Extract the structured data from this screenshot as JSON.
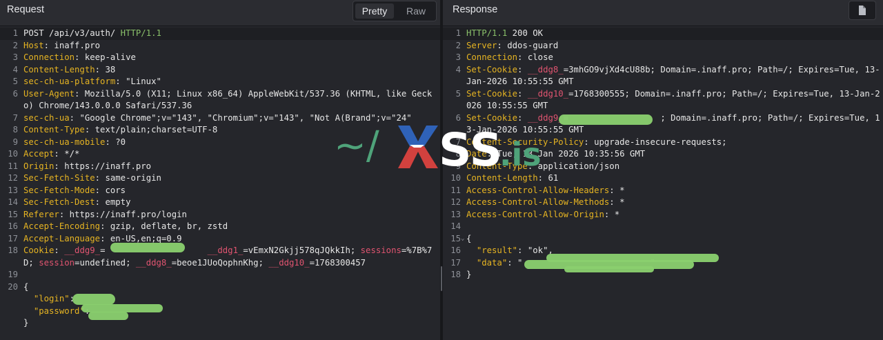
{
  "request": {
    "title": "Request",
    "view_pretty": "Pretty",
    "view_raw": "Raw",
    "lines": [
      {
        "n": "1",
        "parts": [
          {
            "t": "POST /api/v3/auth/ ",
            "c": "m"
          },
          {
            "t": "HTTP/1.1",
            "c": "g"
          }
        ]
      },
      {
        "n": "2",
        "parts": [
          {
            "t": "Host",
            "c": "k"
          },
          {
            "t": ": inaff.pro",
            "c": "m"
          }
        ]
      },
      {
        "n": "3",
        "parts": [
          {
            "t": "Connection",
            "c": "k"
          },
          {
            "t": ": keep-alive",
            "c": "m"
          }
        ]
      },
      {
        "n": "4",
        "parts": [
          {
            "t": "Content-Length",
            "c": "k"
          },
          {
            "t": ": 38",
            "c": "m"
          }
        ]
      },
      {
        "n": "5",
        "parts": [
          {
            "t": "sec-ch-ua-platform",
            "c": "k"
          },
          {
            "t": ": \"Linux\"",
            "c": "m"
          }
        ]
      },
      {
        "n": "6",
        "tall": true,
        "parts": [
          {
            "t": "User-Agent",
            "c": "k"
          },
          {
            "t": ": Mozilla/5.0 (X11; Linux x86_64) AppleWebKit/537.36 (KHTML, like Gecko) Chrome/143.0.0.0 Safari/537.36",
            "c": "m"
          }
        ]
      },
      {
        "n": "7",
        "parts": [
          {
            "t": "sec-ch-ua",
            "c": "k"
          },
          {
            "t": ": \"Google Chrome\";v=\"143\", \"Chromium\";v=\"143\", \"Not A(Brand\";v=\"24\"",
            "c": "m"
          }
        ]
      },
      {
        "n": "8",
        "parts": [
          {
            "t": "Content-Type",
            "c": "k"
          },
          {
            "t": ": text/plain;charset=UTF-8",
            "c": "m"
          }
        ]
      },
      {
        "n": "9",
        "parts": [
          {
            "t": "sec-ch-ua-mobile",
            "c": "k"
          },
          {
            "t": ": ?0",
            "c": "m"
          }
        ]
      },
      {
        "n": "10",
        "parts": [
          {
            "t": "Accept",
            "c": "k"
          },
          {
            "t": ": */*",
            "c": "m"
          }
        ]
      },
      {
        "n": "11",
        "parts": [
          {
            "t": "Origin",
            "c": "k"
          },
          {
            "t": ": https://inaff.pro",
            "c": "m"
          }
        ]
      },
      {
        "n": "12",
        "parts": [
          {
            "t": "Sec-Fetch-Site",
            "c": "k"
          },
          {
            "t": ": same-origin",
            "c": "m"
          }
        ]
      },
      {
        "n": "13",
        "parts": [
          {
            "t": "Sec-Fetch-Mode",
            "c": "k"
          },
          {
            "t": ": cors",
            "c": "m"
          }
        ]
      },
      {
        "n": "14",
        "parts": [
          {
            "t": "Sec-Fetch-Dest",
            "c": "k"
          },
          {
            "t": ": empty",
            "c": "m"
          }
        ]
      },
      {
        "n": "15",
        "parts": [
          {
            "t": "Referer",
            "c": "k"
          },
          {
            "t": ": https://inaff.pro/login",
            "c": "m"
          }
        ]
      },
      {
        "n": "16",
        "parts": [
          {
            "t": "Accept-Encoding",
            "c": "k"
          },
          {
            "t": ": gzip, deflate, br, zstd",
            "c": "m"
          }
        ]
      },
      {
        "n": "17",
        "parts": [
          {
            "t": "Accept-Language",
            "c": "k"
          },
          {
            "t": ": en-US,en;q=0.9",
            "c": "m"
          }
        ]
      },
      {
        "n": "18",
        "tall": true,
        "parts": [
          {
            "t": "Cookie",
            "c": "k"
          },
          {
            "t": ": ",
            "c": "m"
          },
          {
            "t": "__ddg9_",
            "c": "kr"
          },
          {
            "t": "=                    ",
            "c": "m"
          },
          {
            "t": "__ddg1_",
            "c": "kr"
          },
          {
            "t": "=vEmxN2Gkjj578qJQkkIh; ",
            "c": "m"
          },
          {
            "t": "sessions",
            "c": "kr"
          },
          {
            "t": "=%7B%7D; ",
            "c": "m"
          },
          {
            "t": "session",
            "c": "kr"
          },
          {
            "t": "=undefined; ",
            "c": "m"
          },
          {
            "t": "__ddg8_",
            "c": "kr"
          },
          {
            "t": "=beoe1JUoQophnKhg; ",
            "c": "m"
          },
          {
            "t": "__ddg10_",
            "c": "kr"
          },
          {
            "t": "=1768300457",
            "c": "m"
          }
        ]
      },
      {
        "n": "19",
        "parts": []
      },
      {
        "n": "20",
        "parts": [
          {
            "t": "{",
            "c": "m"
          }
        ]
      },
      {
        "n": "",
        "parts": [
          {
            "t": "  \"login\"",
            "c": "k"
          },
          {
            "t": ":",
            "c": "m"
          }
        ]
      },
      {
        "n": "",
        "parts": [
          {
            "t": "  \"password\"",
            "c": "k"
          },
          {
            "t": ":",
            "c": "m"
          }
        ]
      },
      {
        "n": "",
        "parts": [
          {
            "t": "}",
            "c": "m"
          }
        ]
      }
    ]
  },
  "response": {
    "title": "Response",
    "doc_icon": "document-icon",
    "lines": [
      {
        "n": "1",
        "parts": [
          {
            "t": "HTTP/1.1",
            "c": "g"
          },
          {
            "t": " 200 OK",
            "c": "m"
          }
        ]
      },
      {
        "n": "2",
        "parts": [
          {
            "t": "Server",
            "c": "k"
          },
          {
            "t": ": ddos-guard",
            "c": "m"
          }
        ]
      },
      {
        "n": "3",
        "parts": [
          {
            "t": "Connection",
            "c": "k"
          },
          {
            "t": ": close",
            "c": "m"
          }
        ]
      },
      {
        "n": "4",
        "tall": true,
        "parts": [
          {
            "t": "Set-Cookie",
            "c": "k"
          },
          {
            "t": ": ",
            "c": "m"
          },
          {
            "t": "__ddg8_",
            "c": "kr"
          },
          {
            "t": "=3mhGO9vjXd4cU88b; Domain=.inaff.pro; Path=/; Expires=Tue, 13-Jan-2026 10:55:55 GMT",
            "c": "m"
          }
        ]
      },
      {
        "n": "5",
        "tall": true,
        "parts": [
          {
            "t": "Set-Cookie",
            "c": "k"
          },
          {
            "t": ": ",
            "c": "m"
          },
          {
            "t": "__ddg10_",
            "c": "kr"
          },
          {
            "t": "=1768300555; Domain=.inaff.pro; Path=/; Expires=Tue, 13-Jan-2026 10:55:55 GMT",
            "c": "m"
          }
        ]
      },
      {
        "n": "6",
        "tall": true,
        "parts": [
          {
            "t": "Set-Cookie",
            "c": "k"
          },
          {
            "t": ": ",
            "c": "m"
          },
          {
            "t": "__ddg9_",
            "c": "kr"
          },
          {
            "t": "=                  ; Domain=.inaff.pro; Path=/; Expires=Tue, 13-Jan-2026 10:55:55 GMT",
            "c": "m"
          }
        ]
      },
      {
        "n": "7",
        "parts": [
          {
            "t": "Content-Security-Policy",
            "c": "k"
          },
          {
            "t": ": upgrade-insecure-requests;",
            "c": "m"
          }
        ]
      },
      {
        "n": "8",
        "parts": [
          {
            "t": "Date",
            "c": "k"
          },
          {
            "t": ": Tue, 13 Jan 2026 10:35:56 GMT",
            "c": "m"
          }
        ]
      },
      {
        "n": "9",
        "parts": [
          {
            "t": "Content-Type",
            "c": "k"
          },
          {
            "t": ": application/json",
            "c": "m"
          }
        ]
      },
      {
        "n": "10",
        "parts": [
          {
            "t": "Content-Length",
            "c": "k"
          },
          {
            "t": ": 61",
            "c": "m"
          }
        ]
      },
      {
        "n": "11",
        "parts": [
          {
            "t": "Access-Control-Allow-Headers",
            "c": "k"
          },
          {
            "t": ": *",
            "c": "m"
          }
        ]
      },
      {
        "n": "12",
        "parts": [
          {
            "t": "Access-Control-Allow-Methods",
            "c": "k"
          },
          {
            "t": ": *",
            "c": "m"
          }
        ]
      },
      {
        "n": "13",
        "parts": [
          {
            "t": "Access-Control-Allow-Origin",
            "c": "k"
          },
          {
            "t": ": *",
            "c": "m"
          }
        ]
      },
      {
        "n": "14",
        "parts": []
      },
      {
        "n": "15",
        "fold": true,
        "parts": [
          {
            "t": "{",
            "c": "m"
          }
        ]
      },
      {
        "n": "16",
        "parts": [
          {
            "t": "  \"result\"",
            "c": "k"
          },
          {
            "t": ": ",
            "c": "m"
          },
          {
            "t": "\"ok\"",
            "c": "s"
          },
          {
            "t": ",",
            "c": "m"
          }
        ]
      },
      {
        "n": "17",
        "parts": [
          {
            "t": "  \"data\"",
            "c": "k"
          },
          {
            "t": ": ",
            "c": "m"
          },
          {
            "t": "\"                         \"",
            "c": "s"
          }
        ]
      },
      {
        "n": "18",
        "parts": [
          {
            "t": "}",
            "c": "m"
          }
        ]
      }
    ]
  },
  "watermark": {
    "prefix": "~/",
    "x_letter": "X",
    "rest": "SS",
    "suffix": ".is",
    "colors": {
      "slash": "#4fa37a",
      "x_top": "#2f62b8",
      "x_bottom": "#d2413e",
      "text": "#ffffff",
      "dot_is": "#4fa37a"
    }
  },
  "colors": {
    "header_key": "#e6b422",
    "cookie_name": "#e05470",
    "http_version": "#8ac06a",
    "redaction": "#8ad06f"
  }
}
